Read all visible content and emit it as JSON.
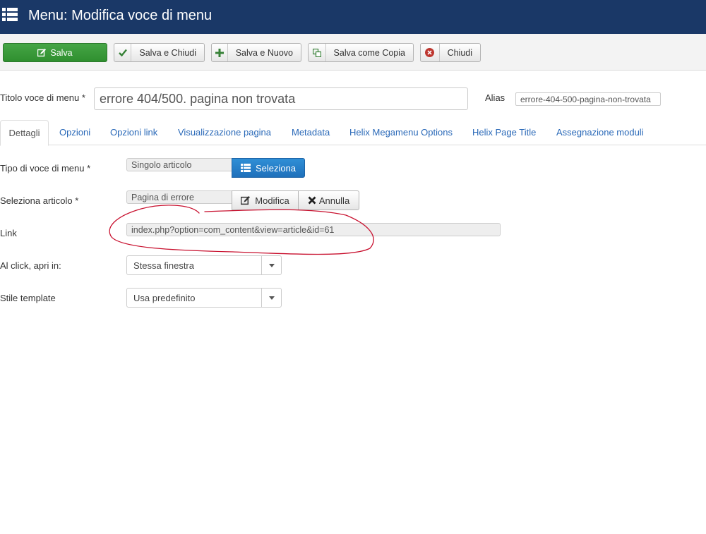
{
  "header": {
    "title": "Menu: Modifica voce di menu",
    "icon": "list-icon",
    "bg": "#1a3867"
  },
  "toolbar": {
    "save": "Salva",
    "save_close": "Salva e Chiudi",
    "save_new": "Salva e Nuovo",
    "save_copy": "Salva come Copia",
    "close": "Chiudi"
  },
  "form": {
    "title_label": "Titolo voce di menu *",
    "title_value": "errore 404/500. pagina non trovata",
    "alias_label": "Alias",
    "alias_value": "errore-404-500-pagina-non-trovata"
  },
  "tabs": [
    {
      "label": "Dettagli",
      "active": true
    },
    {
      "label": "Opzioni"
    },
    {
      "label": "Opzioni link"
    },
    {
      "label": "Visualizzazione pagina"
    },
    {
      "label": "Metadata"
    },
    {
      "label": "Helix Megamenu Options"
    },
    {
      "label": "Helix Page Title"
    },
    {
      "label": "Assegnazione moduli"
    }
  ],
  "details": {
    "type_label": "Tipo di voce di menu *",
    "type_value": "Singolo articolo",
    "select_button": "Seleziona",
    "article_label": "Seleziona articolo *",
    "article_value": "Pagina di errore",
    "edit_button": "Modifica",
    "cancel_button": "Annulla",
    "link_label": "Link",
    "link_value": "index.php?option=com_content&view=article&id=61",
    "target_label": "Al click, apri in:",
    "target_value": "Stessa finestra",
    "template_label": "Stile template",
    "template_value": "Usa predefinito"
  },
  "colors": {
    "save_green": "#3c9d3c",
    "select_blue": "#2384cf",
    "link_blue": "#2a69b8",
    "annotation_red": "#c8102e"
  }
}
